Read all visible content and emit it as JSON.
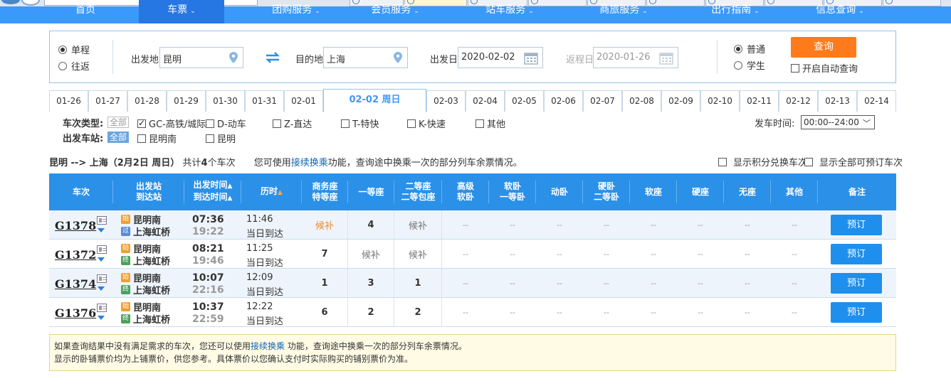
{
  "nav": {
    "items": [
      {
        "label": "首页",
        "chev": false
      },
      {
        "label": "车票",
        "chev": true,
        "active": true
      },
      {
        "label": "团购服务",
        "chev": true
      },
      {
        "label": "会员服务",
        "chev": true
      },
      {
        "label": "站车服务",
        "chev": true
      },
      {
        "label": "商旅服务",
        "chev": true
      },
      {
        "label": "出行指南",
        "chev": true
      },
      {
        "label": "信息查询",
        "chev": true
      }
    ],
    "chev_glyph": "⌄"
  },
  "search": {
    "trip_type": {
      "one_way": "单程",
      "round_trip": "往返",
      "selected": "one_way"
    },
    "from_label": "出发地",
    "from_value": "昆明",
    "to_label": "目的地",
    "to_value": "上海",
    "depart_label": "出发日",
    "depart_value": "2020-02-02",
    "return_label": "返程日",
    "return_value": "2020-01-26",
    "passenger": {
      "normal": "普通",
      "student": "学生",
      "selected": "normal"
    },
    "search_button": "查询",
    "auto_query_label": "开启自动查询"
  },
  "date_tabs": [
    "01-26",
    "01-27",
    "01-28",
    "01-29",
    "01-30",
    "01-31",
    "02-01",
    "02-02  周日",
    "02-03",
    "02-04",
    "02-05",
    "02-06",
    "02-07",
    "02-08",
    "02-09",
    "02-10",
    "02-11",
    "02-12",
    "02-13",
    "02-14"
  ],
  "active_date_index": 7,
  "filters": {
    "train_type_label": "车次类型:",
    "all_label": "全部",
    "train_types": [
      {
        "label": "GC-高铁/城际",
        "checked": true
      },
      {
        "label": "D-动车",
        "checked": false
      },
      {
        "label": "Z-直达",
        "checked": false
      },
      {
        "label": "T-特快",
        "checked": false
      },
      {
        "label": "K-快速",
        "checked": false
      },
      {
        "label": "其他",
        "checked": false
      }
    ],
    "station_label": "出发车站:",
    "stations": [
      {
        "label": "昆明南",
        "checked": false
      },
      {
        "label": "昆明",
        "checked": false
      }
    ],
    "depart_time_label": "发车时间:",
    "depart_time_value": "00:00--24:00"
  },
  "summary": {
    "route": "昆明 --> 上海（2月2日  周日）",
    "count_prefix": "共计",
    "count": "4",
    "count_suffix": "个车次",
    "hint_prefix": "您可使用",
    "hint_link": "接续换乘",
    "hint_suffix": "功能，查询途中换乘一次的部分列车余票情况。",
    "show_points": "显示积分兑换车次",
    "show_all": "显示全部可预订车次"
  },
  "table": {
    "headers": [
      {
        "l1": "车次",
        "l2": ""
      },
      {
        "l1": "出发站",
        "l2": "到达站"
      },
      {
        "l1": "出发时间",
        "l2": "到达时间"
      },
      {
        "l1": "历时",
        "l2": ""
      },
      {
        "l1": "商务座",
        "l2": "特等座"
      },
      {
        "l1": "一等座",
        "l2": ""
      },
      {
        "l1": "二等座",
        "l2": "二等包座"
      },
      {
        "l1": "高级",
        "l2": "软卧"
      },
      {
        "l1": "软卧",
        "l2": "一等卧"
      },
      {
        "l1": "动卧",
        "l2": ""
      },
      {
        "l1": "硬卧",
        "l2": "二等卧"
      },
      {
        "l1": "软座",
        "l2": ""
      },
      {
        "l1": "硬座",
        "l2": ""
      },
      {
        "l1": "无座",
        "l2": ""
      },
      {
        "l1": "其他",
        "l2": ""
      },
      {
        "l1": "备注",
        "l2": ""
      }
    ],
    "sort_arrow": "▲",
    "start_glyph": "始",
    "pass_glyph": "过",
    "end_glyph": "终",
    "rows": [
      {
        "train": "G1378",
        "from": "昆明南",
        "to": "上海虹桥",
        "to_kind": "pass",
        "dep": "07:36",
        "arr": "19:22",
        "dur": "11:46",
        "dur_sub": "当日到达",
        "seats": [
          "候补",
          "4",
          "候补",
          "--",
          "--",
          "--",
          "--",
          "--",
          "--",
          "--",
          "--"
        ],
        "book": "预订"
      },
      {
        "train": "G1372",
        "from": "昆明南",
        "to": "上海虹桥",
        "to_kind": "end",
        "dep": "08:21",
        "arr": "19:46",
        "dur": "11:25",
        "dur_sub": "当日到达",
        "seats": [
          "7",
          "候补",
          "候补",
          "--",
          "--",
          "--",
          "--",
          "--",
          "--",
          "--",
          "--"
        ],
        "book": "预订"
      },
      {
        "train": "G1374",
        "from": "昆明南",
        "to": "上海虹桥",
        "to_kind": "end",
        "dep": "10:07",
        "arr": "22:16",
        "dur": "12:09",
        "dur_sub": "当日到达",
        "seats": [
          "1",
          "3",
          "1",
          "--",
          "--",
          "--",
          "--",
          "--",
          "--",
          "--",
          "--"
        ],
        "book": "预订"
      },
      {
        "train": "G1376",
        "from": "昆明南",
        "to": "上海虹桥",
        "to_kind": "end",
        "dep": "10:37",
        "arr": "22:59",
        "dur": "12:22",
        "dur_sub": "当日到达",
        "seats": [
          "6",
          "2",
          "2",
          "--",
          "--",
          "--",
          "--",
          "--",
          "--",
          "--",
          "--"
        ],
        "book": "预订"
      }
    ]
  },
  "notice": {
    "line1_prefix": "如果查询结果中没有满足需求的车次，您还可以使用",
    "line1_link": "接续换乘",
    "line1_suffix": " 功能，查询途中换乘一次的部分列车余票情况。",
    "line2": "显示的卧铺票价均为上铺票价，供您参考。具体票价以您确认支付时实际购买的铺别票价为准。"
  },
  "colors": {
    "accent": "#3b99fc",
    "header": "#2b90e8",
    "orange": "#ff7a1a",
    "link": "#1266b6"
  }
}
